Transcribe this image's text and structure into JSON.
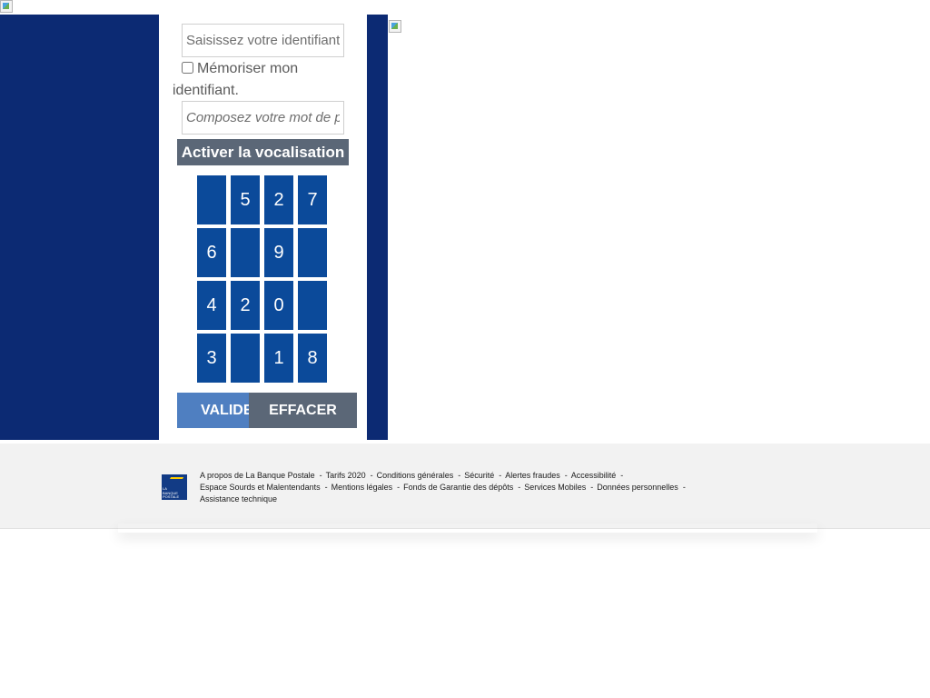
{
  "login": {
    "identifier_placeholder": "Saisissez votre identifiant",
    "remember_label": "Mémoriser mon identifiant.",
    "password_placeholder": "Composez votre mot de passe",
    "vocalisation_label": "Activer la vocalisation",
    "validate_label": "VALIDER",
    "clear_label": "EFFACER"
  },
  "keypad": {
    "keys": [
      "",
      "5",
      "2",
      "7",
      "6",
      "",
      "9",
      "",
      "4",
      "2",
      "0",
      "",
      "3",
      "",
      "1",
      "8"
    ]
  },
  "footer": {
    "logo_text": [
      "LA",
      "BANQUE",
      "POSTALE"
    ],
    "links": [
      "A propos de La Banque Postale",
      "Tarifs 2020",
      "Conditions générales",
      "Sécurité",
      "Alertes fraudes",
      "Accessibilité",
      "Espace Sourds et Malentendants",
      "Mentions légales",
      "Fonds de Garantie des dépôts",
      "Services Mobiles",
      "Données personnelles",
      "Assistance technique"
    ],
    "separator": "-"
  },
  "colors": {
    "navy": "#0c2a73",
    "key_blue": "#0b4a9a",
    "slate_button": "#5b6777",
    "validate_blue": "#4f7fc1",
    "footer_bg": "#f2f2f2"
  },
  "icons": {
    "top_image": "broken-image-icon",
    "side_image": "broken-image-icon"
  }
}
